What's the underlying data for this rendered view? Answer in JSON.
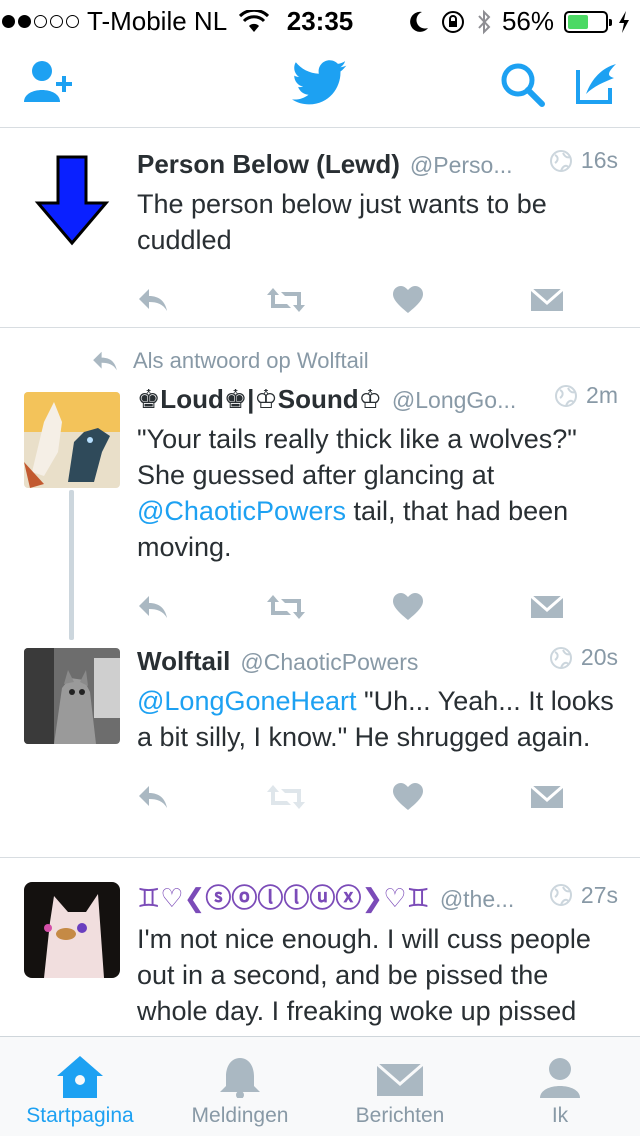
{
  "status_bar": {
    "carrier": "T-Mobile NL",
    "time": "23:35",
    "battery": "56%",
    "battery_level": 0.56,
    "signal_bars_filled": 2,
    "signal_bars_total": 5
  },
  "nav": {
    "left_icon": "add-user-icon",
    "center_icon": "twitter-bird-icon",
    "right_icons": [
      "search-icon",
      "compose-icon"
    ]
  },
  "colors": {
    "accent": "#1da1f2",
    "muted": "#8899a6",
    "text": "#292f33",
    "divider": "#d8dde1"
  },
  "tweets": [
    {
      "name": "Person Below (Lewd)",
      "handle": "@Perso...",
      "time": "16s",
      "text": "The person below just wants to be cuddled"
    },
    {
      "context": "Als antwoord op Wolftail",
      "name": "♚Loud♚|♔Sound♔",
      "handle": "@LongGo...",
      "time": "2m",
      "text_before": "\"Your tails really thick like a wolves?\" She guessed after glancing at ",
      "mention": "@ChaoticPowers",
      "text_after": " tail, that had been moving."
    },
    {
      "name": "Wolftail",
      "handle": "@ChaoticPowers",
      "time": "20s",
      "mention": "@LongGoneHeart",
      "text_after": " \"Uh... Yeah... It looks a bit silly, I know.\" He shrugged again."
    },
    {
      "name": "♊♡❮ⓢⓞⓛⓛⓤⓧ❯♡♊",
      "handle": "@the...",
      "time": "27s",
      "text": "I'm not nice enough. I will cuss people out in a second, and be pissed the whole day. I freaking woke up pissed XD"
    }
  ],
  "tabs": [
    {
      "label": "Startpagina",
      "icon": "home-icon",
      "active": true
    },
    {
      "label": "Meldingen",
      "icon": "bell-icon",
      "active": false
    },
    {
      "label": "Berichten",
      "icon": "envelope-icon",
      "active": false
    },
    {
      "label": "Ik",
      "icon": "profile-icon",
      "active": false
    }
  ]
}
